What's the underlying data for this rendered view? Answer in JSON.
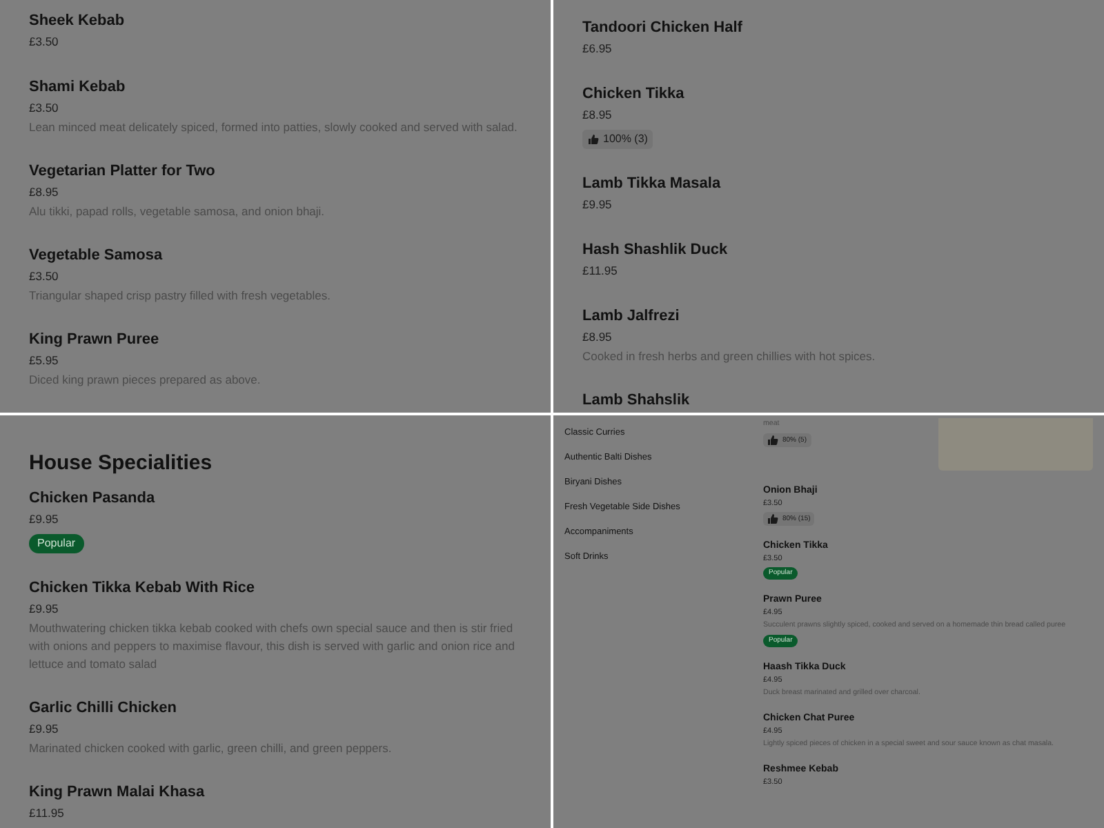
{
  "panels": [
    {
      "kind": "full",
      "items": [
        {
          "name": "Sheek Kebab",
          "price": "£3.50"
        },
        {
          "name": "Shami Kebab",
          "price": "£3.50",
          "description": "Lean minced meat delicately spiced, formed into patties, slowly cooked and served with salad."
        },
        {
          "name": "Vegetarian Platter for Two",
          "price": "£8.95",
          "description": "Alu tikki, papad rolls, vegetable samosa, and onion bhaji."
        },
        {
          "name": "Vegetable Samosa",
          "price": "£3.50",
          "description": "Triangular shaped crisp pastry filled with fresh vegetables."
        },
        {
          "name": "King Prawn Puree",
          "price": "£5.95",
          "description": "Diced king prawn pieces prepared as above."
        }
      ]
    },
    {
      "kind": "full",
      "items": [
        {
          "name": "Tandoori Chicken Half",
          "price": "£6.95"
        },
        {
          "name": "Chicken Tikka",
          "price": "£8.95",
          "rating": "100% (3)"
        },
        {
          "name": "Lamb Tikka Masala",
          "price": "£9.95"
        },
        {
          "name": "Hash Shashlik Duck",
          "price": "£11.95"
        },
        {
          "name": "Lamb Jalfrezi",
          "price": "£8.95",
          "description": "Cooked in fresh herbs and green chillies with hot spices."
        },
        {
          "name": "Lamb Shahslik"
        }
      ]
    },
    {
      "kind": "full",
      "heading": "House Specialities",
      "items": [
        {
          "name": "Chicken Pasanda",
          "price": "£9.95",
          "badge": "Popular"
        },
        {
          "name": "Chicken Tikka Kebab With Rice",
          "price": "£9.95",
          "description": "Mouthwatering chicken tikka kebab cooked with chefs own special sauce and then is stir fried with onions and peppers to maximise flavour, this dish is served with garlic and onion rice and lettuce and tomato salad"
        },
        {
          "name": "Garlic Chilli Chicken",
          "price": "£9.95",
          "description": "Marinated chicken cooked with garlic, green chilli, and green peppers."
        },
        {
          "name": "King Prawn Malai Khasa",
          "price": "£11.95"
        }
      ]
    },
    {
      "kind": "compact",
      "categories": [
        "Classic Curries",
        "Authentic Balti Dishes",
        "Biryani Dishes",
        "Fresh Vegetable Side Dishes",
        "Accompaniments",
        "Soft Drinks"
      ],
      "items": [
        {
          "description": "meat",
          "rating": "80% (5)",
          "has_photo": true
        },
        {
          "name": "Onion Bhaji",
          "price": "£3.50",
          "rating": "80% (15)"
        },
        {
          "name": "Chicken Tikka",
          "price": "£3.50",
          "badge": "Popular"
        },
        {
          "name": "Prawn Puree",
          "price": "£4.95",
          "description": "Succulent prawns slightly spiced, cooked and served on a homemade thin bread called puree",
          "badge": "Popular"
        },
        {
          "name": "Haash Tikka Duck",
          "price": "£4.95",
          "description": "Duck breast marinated and grilled over charcoal."
        },
        {
          "name": "Chicken Chat Puree",
          "price": "£4.95",
          "description": "Lightly spiced pieces of chicken in a special sweet and sour sauce known as chat masala."
        },
        {
          "name": "Reshmee Kebab",
          "price": "£3.50"
        }
      ]
    }
  ]
}
